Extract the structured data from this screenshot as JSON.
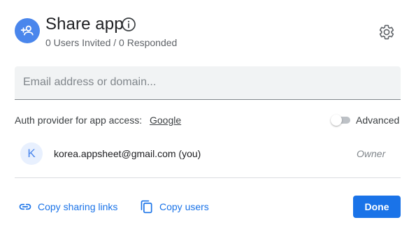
{
  "header": {
    "title": "Share app",
    "subtitle": "0 Users Invited / 0 Responded",
    "share_icon": "person-add-icon",
    "info_icon": "info-icon",
    "settings_icon": "gear-icon"
  },
  "invite": {
    "placeholder": "Email address or domain...",
    "value": ""
  },
  "auth": {
    "label": "Auth provider for app access:",
    "provider": "Google",
    "advanced_label": "Advanced",
    "advanced_enabled": false
  },
  "users": [
    {
      "initial": "K",
      "email": "korea.appsheet@gmail.com (you)",
      "role": "Owner"
    }
  ],
  "footer": {
    "copy_links_label": "Copy sharing links",
    "copy_users_label": "Copy users",
    "done_label": "Done"
  },
  "colors": {
    "accent": "#1a73e8",
    "share_avatar": "#4a86ec",
    "user_avatar_bg": "#e8f0fe"
  }
}
